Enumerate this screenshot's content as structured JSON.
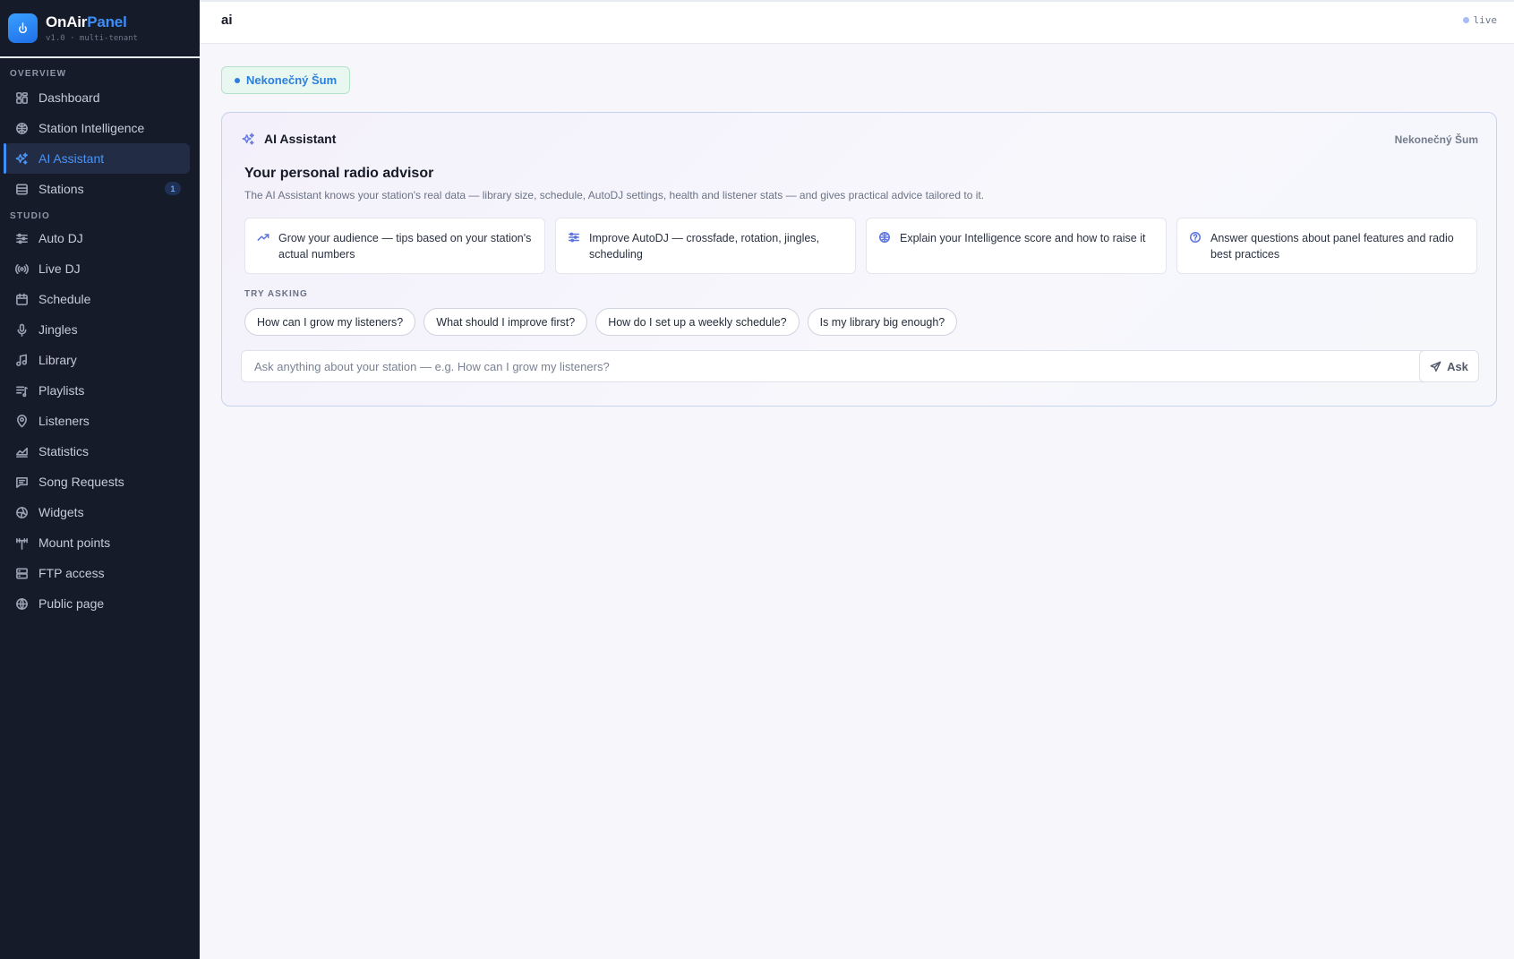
{
  "brand": {
    "name_main": "OnAir",
    "name_accent": "Panel",
    "subtitle": "v1.0 · multi-tenant"
  },
  "sidebar": {
    "sections": [
      {
        "label": "OVERVIEW",
        "items": [
          {
            "label": "Dashboard",
            "icon": "dashboard-icon"
          },
          {
            "label": "Station Intelligence",
            "icon": "brain-icon"
          },
          {
            "label": "AI Assistant",
            "icon": "sparkles-icon",
            "active": true
          },
          {
            "label": "Stations",
            "icon": "database-icon",
            "badge": "1"
          }
        ]
      },
      {
        "label": "STUDIO",
        "items": [
          {
            "label": "Auto DJ",
            "icon": "sliders-icon"
          },
          {
            "label": "Live DJ",
            "icon": "broadcast-icon"
          },
          {
            "label": "Schedule",
            "icon": "calendar-icon"
          },
          {
            "label": "Jingles",
            "icon": "microphone-icon"
          },
          {
            "label": "Library",
            "icon": "music-note-icon"
          },
          {
            "label": "Playlists",
            "icon": "playlist-icon"
          },
          {
            "label": "Listeners",
            "icon": "map-pin-icon"
          },
          {
            "label": "Statistics",
            "icon": "area-chart-icon"
          },
          {
            "label": "Song Requests",
            "icon": "message-icon"
          },
          {
            "label": "Widgets",
            "icon": "widget-icon"
          },
          {
            "label": "Mount points",
            "icon": "antenna-icon"
          },
          {
            "label": "FTP access",
            "icon": "server-icon"
          },
          {
            "label": "Public page",
            "icon": "globe-icon"
          }
        ]
      }
    ]
  },
  "topbar": {
    "title": "ai",
    "status": "live"
  },
  "station_chip": "Nekonečný Šum",
  "assistant": {
    "header_title": "AI Assistant",
    "station_name": "Nekonečný Šum",
    "heading": "Your personal radio advisor",
    "description": "The AI Assistant knows your station's real data — library size, schedule, AutoDJ settings, health and listener stats — and gives practical advice tailored to it.",
    "features": [
      {
        "icon": "trending-up-icon",
        "text": "Grow your audience — tips based on your station's actual numbers"
      },
      {
        "icon": "sliders-icon",
        "text": "Improve AutoDJ — crossfade, rotation, jingles, scheduling"
      },
      {
        "icon": "brain-icon",
        "text": "Explain your Intelligence score and how to raise it"
      },
      {
        "icon": "help-circle-icon",
        "text": "Answer questions about panel features and radio best practices"
      }
    ],
    "try_label": "TRY ASKING",
    "suggestions": [
      "How can I grow my listeners?",
      "What should I improve first?",
      "How do I set up a weekly schedule?",
      "Is my library big enough?"
    ],
    "input": {
      "value": "",
      "placeholder": "Ask anything about your station — e.g. How can I grow my listeners?"
    },
    "ask_label": "Ask"
  },
  "colors": {
    "sidebar_bg": "#161b2a",
    "accent": "#3e8ef7",
    "page_bg": "#f6f6fb"
  }
}
